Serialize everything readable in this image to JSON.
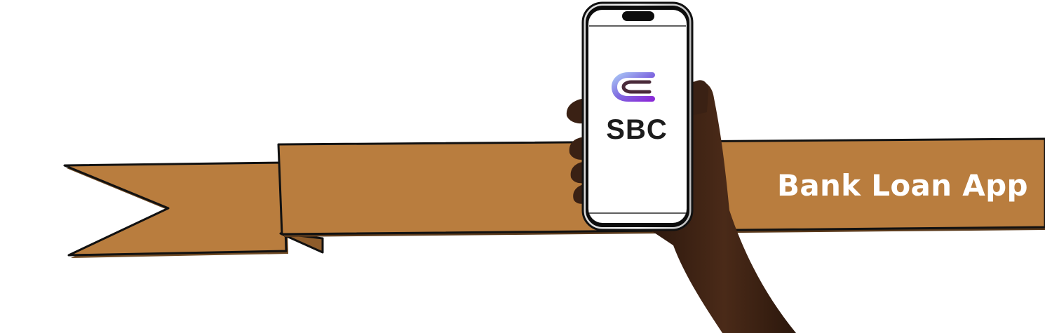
{
  "banner": {
    "title": "Bank Loan App"
  },
  "phone": {
    "brand_name": "SBC",
    "logo_icon": "sbc-logo-icon"
  },
  "colors": {
    "ribbon": "#B97D3E",
    "ribbon_outline": "#111111",
    "skin": "#3F2416",
    "logo_gradient_start": "#9EB7F2",
    "logo_gradient_end": "#8A2BD8"
  }
}
